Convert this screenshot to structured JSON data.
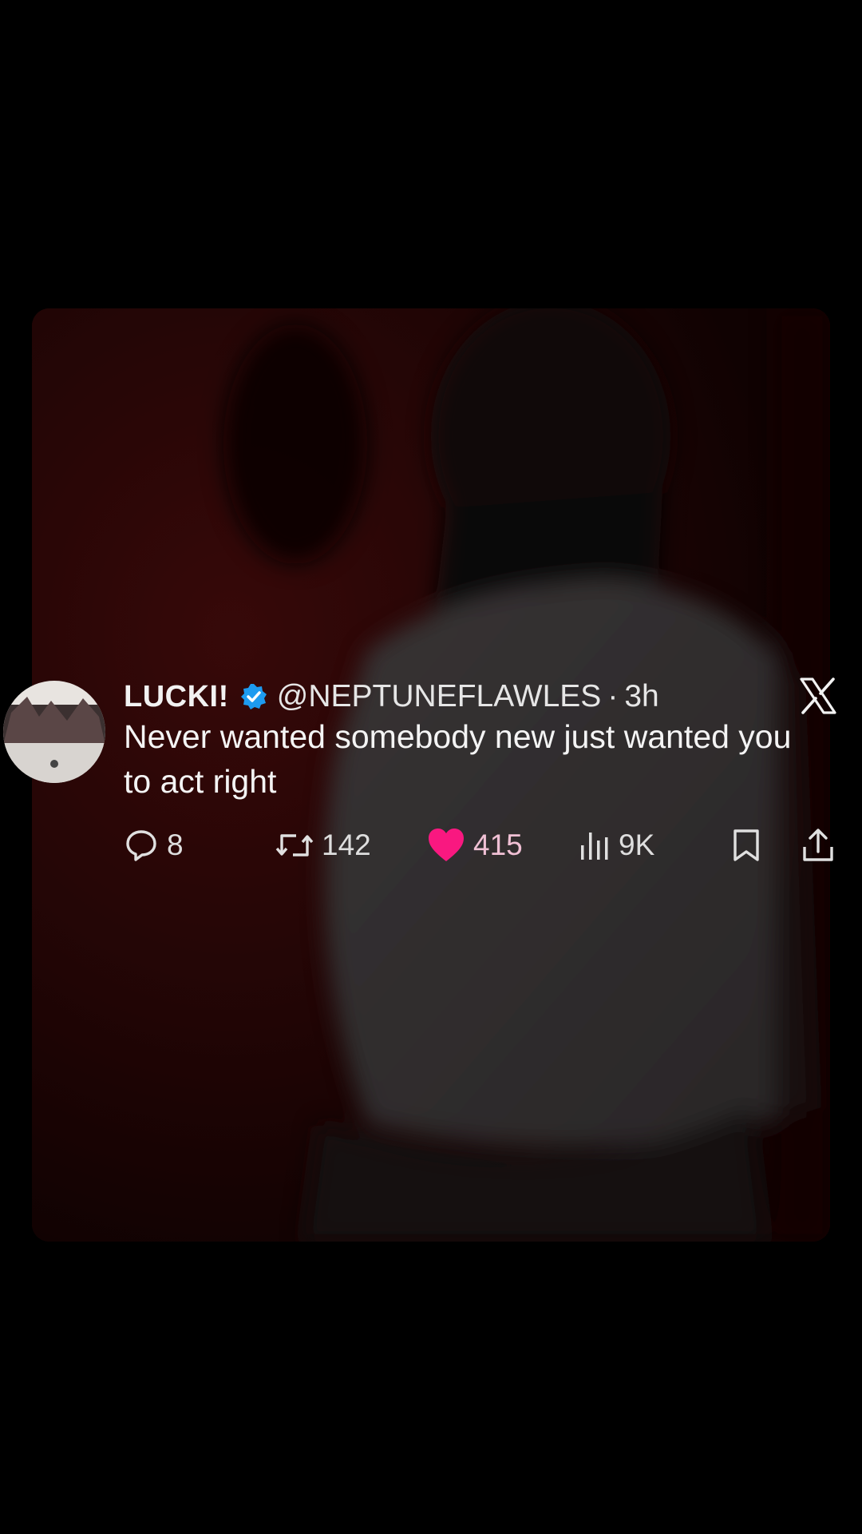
{
  "tweet": {
    "display_name": "LUCKI!",
    "handle": "@NEPTUNEFLAWLES",
    "separator": "·",
    "time": "3h",
    "text": "Never wanted somebody new just wanted you to act right",
    "verified": true
  },
  "actions": {
    "replies": "8",
    "reposts": "142",
    "likes": "415",
    "views": "9K"
  },
  "icons": {
    "reply": "reply-icon",
    "repost": "repost-icon",
    "like": "heart-icon",
    "views": "views-icon",
    "bookmark": "bookmark-icon",
    "share": "share-icon",
    "brand": "x-logo-icon",
    "verified": "verified-badge-icon"
  },
  "colors": {
    "background": "#000000",
    "video_tint": "#2a0606",
    "like_active": "#f91880",
    "verified_badge": "#1d9bf0"
  }
}
